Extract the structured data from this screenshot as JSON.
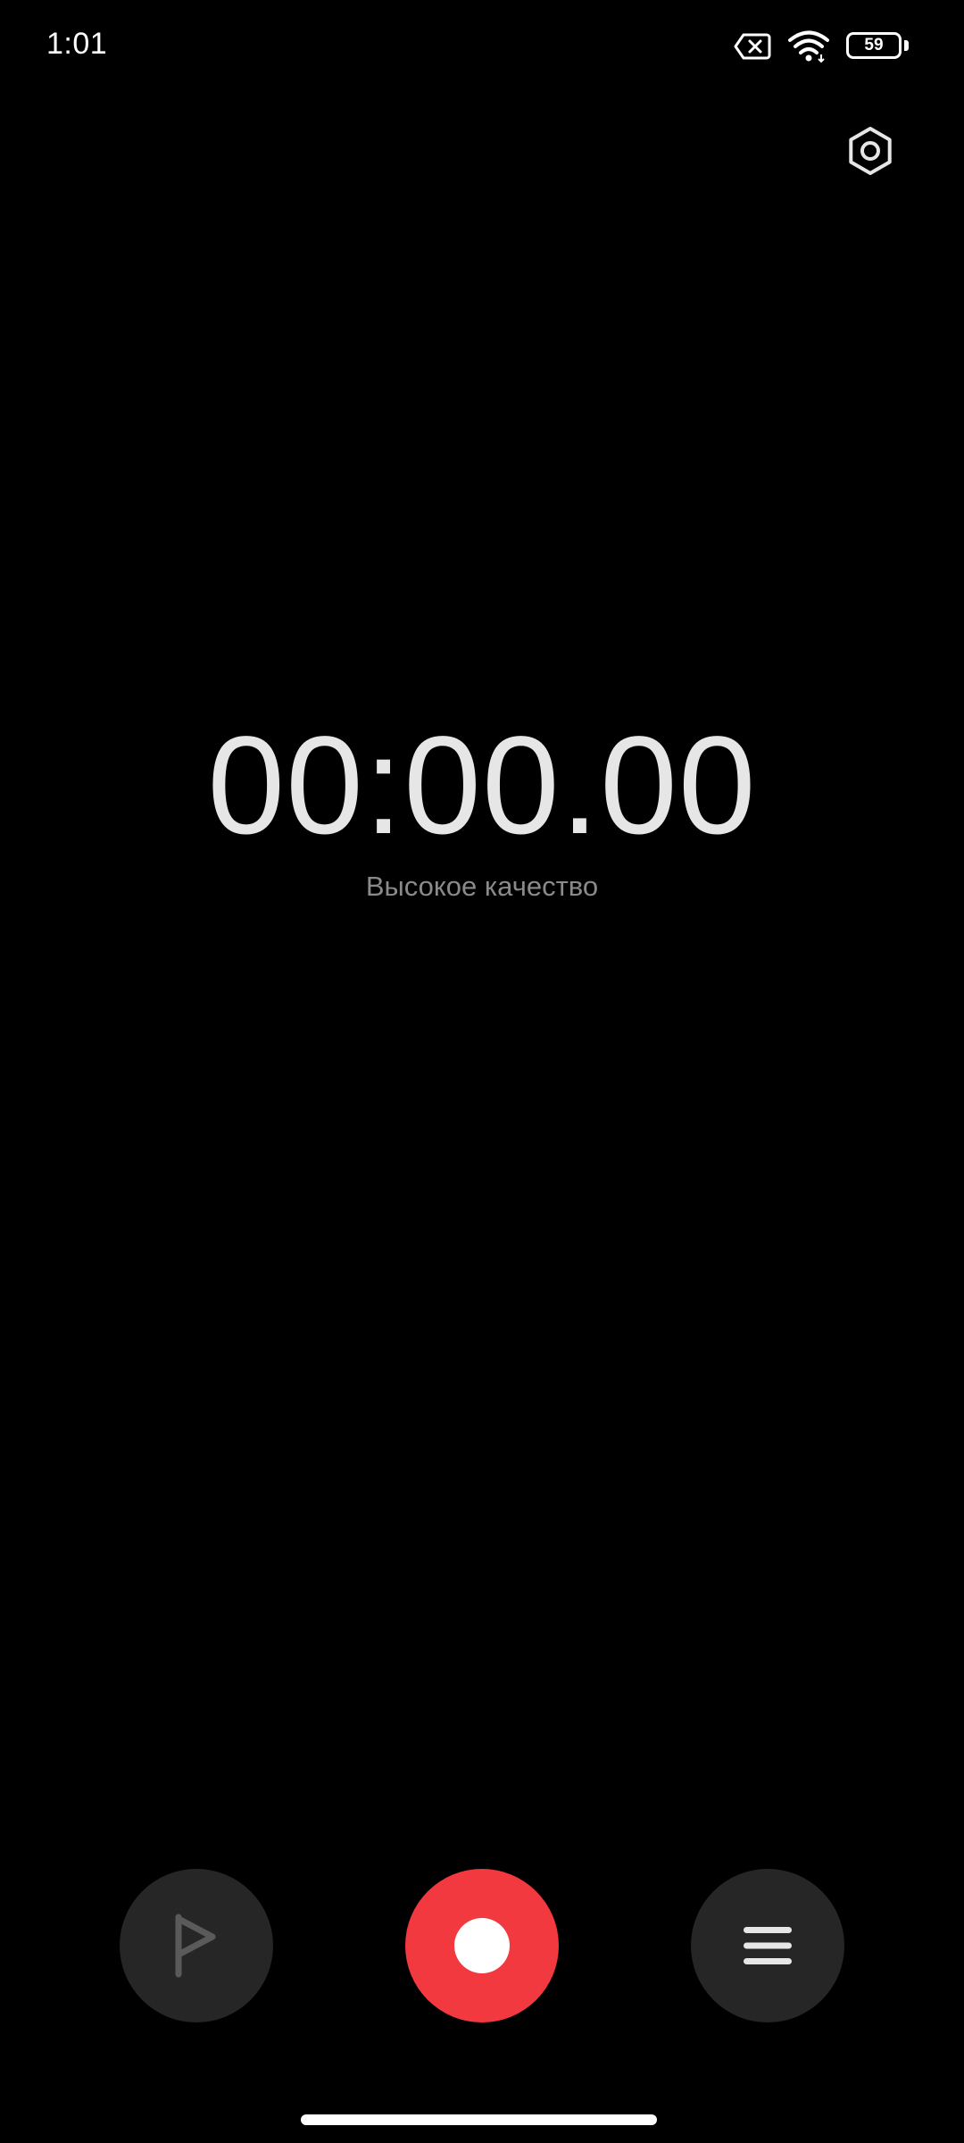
{
  "status_bar": {
    "time": "1:01",
    "icons": [
      "no-sim-icon",
      "wifi-icon",
      "battery-icon"
    ],
    "battery_level": "59"
  },
  "toolbar": {
    "settings_icon": "settings-hexagon-icon"
  },
  "recorder": {
    "timer": "00:00.00",
    "quality": "Высокое качество"
  },
  "controls": {
    "flag_icon": "flag-icon",
    "record_icon": "record-icon",
    "list_icon": "list-icon",
    "record_color": "#f2393f",
    "button_color": "#262626"
  },
  "colors": {
    "background": "#000000",
    "timer_text": "#e6e6e6",
    "secondary_text": "#8a8a8a"
  }
}
